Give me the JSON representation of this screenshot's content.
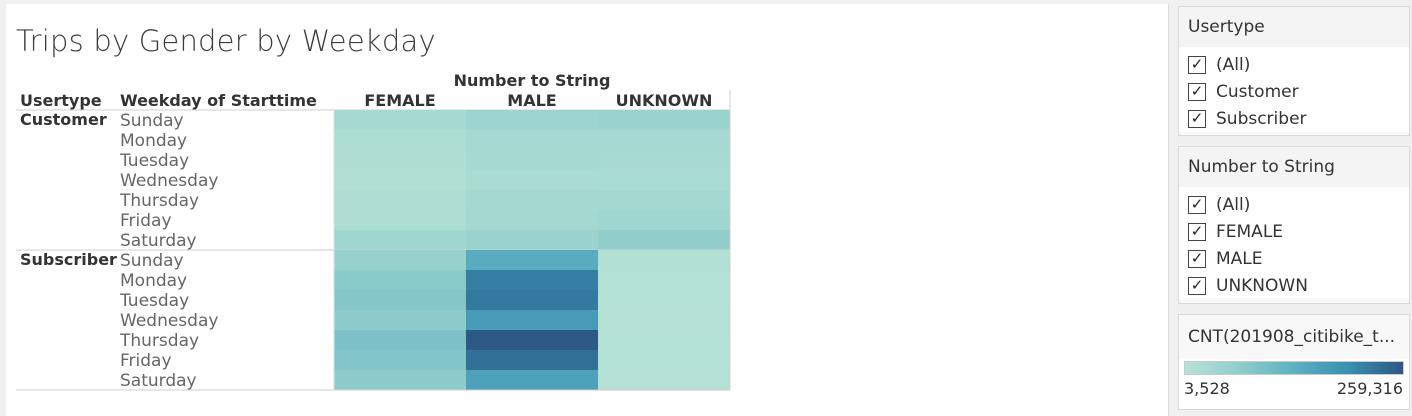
{
  "chart_data": {
    "type": "heatmap",
    "title": "Trips by Gender by Weekday",
    "column_header": "Number to String",
    "row_headers": [
      "Usertype",
      "Weekday of Starttime"
    ],
    "columns": [
      "FEMALE",
      "MALE",
      "UNKNOWN"
    ],
    "groups": [
      {
        "name": "Customer",
        "rows": [
          "Sunday",
          "Monday",
          "Tuesday",
          "Wednesday",
          "Thursday",
          "Friday",
          "Saturday"
        ],
        "values": [
          [
            30000,
            45000,
            50000
          ],
          [
            18000,
            32000,
            30000
          ],
          [
            16000,
            30000,
            28000
          ],
          [
            14000,
            26000,
            25000
          ],
          [
            18000,
            33000,
            35000
          ],
          [
            20000,
            35000,
            40000
          ],
          [
            40000,
            50000,
            65000
          ]
        ]
      },
      {
        "name": "Subscriber",
        "rows": [
          "Sunday",
          "Monday",
          "Tuesday",
          "Wednesday",
          "Thursday",
          "Friday",
          "Saturday"
        ],
        "values": [
          [
            55000,
            140000,
            10000
          ],
          [
            75000,
            215000,
            8000
          ],
          [
            80000,
            222000,
            8000
          ],
          [
            70000,
            172000,
            7000
          ],
          [
            92000,
            259316,
            8000
          ],
          [
            85000,
            232000,
            8000
          ],
          [
            70000,
            160000,
            9000
          ]
        ]
      }
    ],
    "color_scale": {
      "label": "CNT(201908_citibike_t...",
      "min": 3528,
      "max": 259316,
      "min_label": "3,528",
      "max_label": "259,316",
      "colors": [
        "#b7e2d6",
        "#8fcdcb",
        "#5eb0c2",
        "#3a8fb1",
        "#2c5985"
      ]
    }
  },
  "filters": [
    {
      "title": "Usertype",
      "options": [
        "(All)",
        "Customer",
        "Subscriber"
      ],
      "checked": [
        true,
        true,
        true
      ]
    },
    {
      "title": "Number to String",
      "options": [
        "(All)",
        "FEMALE",
        "MALE",
        "UNKNOWN"
      ],
      "checked": [
        true,
        true,
        true,
        true
      ]
    }
  ],
  "checkmark_icon": "check-icon"
}
